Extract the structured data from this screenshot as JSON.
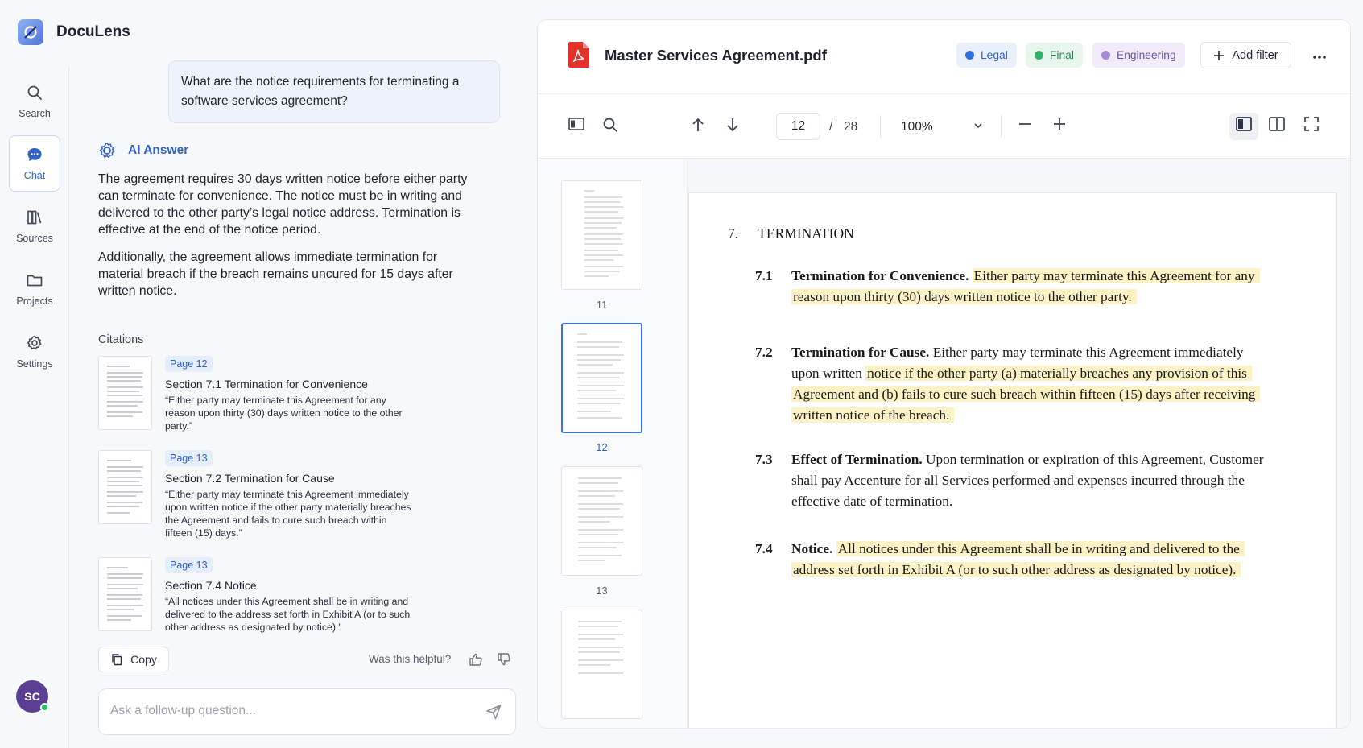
{
  "app": {
    "name": "DocuLens"
  },
  "nav": {
    "items": [
      {
        "label": "Search",
        "icon": "search-icon"
      },
      {
        "label": "Chat",
        "icon": "chat-icon"
      },
      {
        "label": "Sources",
        "icon": "library-icon"
      },
      {
        "label": "Projects",
        "icon": "folder-icon"
      },
      {
        "label": "Settings",
        "icon": "gear-icon"
      }
    ],
    "active": "Chat",
    "user_initials": "SC"
  },
  "chat": {
    "question": "What are the notice requirements for terminating a software services agreement?",
    "ai_label": "AI Answer",
    "answer_p1": "The agreement requires 30 days written notice before either party can terminate for convenience. The notice must be in writing and delivered to the other party’s legal notice address. Termination is effective at the end of the notice period.",
    "answer_p2": "Additionally, the agreement allows immediate termination for material breach if the breach remains uncured for 15 days after written notice.",
    "citations_label": "Citations",
    "citations": [
      {
        "page": "Page 12",
        "title": "Section 7.1 Termination for Convenience",
        "quote": "“Either party may terminate this Agreement for any reason upon thirty (30) days written notice to the other party.”"
      },
      {
        "page": "Page 13",
        "title": "Section 7.2 Termination for Cause",
        "quote": "“Either party may terminate this Agreement immediately upon written notice if the other party materially breaches the Agreement and fails to cure such breach within fifteen (15) days.”"
      },
      {
        "page": "Page 13",
        "title": "Section 7.4 Notice",
        "quote": "“All notices under this Agreement shall be in writing and delivered to the address set forth in Exhibit A (or to such other address as designated by notice).”"
      }
    ],
    "copy_label": "Copy",
    "helpful_label": "Was this helpful?",
    "followup_placeholder": "Ask a follow-up question..."
  },
  "viewer": {
    "doc_title": "Master Services Agreement.pdf",
    "tags": [
      {
        "label": "Legal",
        "color": "#2f6fe0",
        "bg": "#eaf1fd",
        "text": "#2f63c8"
      },
      {
        "label": "Final",
        "color": "#2fb36a",
        "bg": "#e8f6ee",
        "text": "#2a8f55"
      },
      {
        "label": "Engineering",
        "color": "#a48ad8",
        "bg": "#f1ecfa",
        "text": "#6c55a8"
      }
    ],
    "add_filter_label": "Add filter",
    "page_current": "12",
    "page_sep": "/",
    "page_total": "28",
    "zoom": "100%",
    "thumbnails": [
      "11",
      "12",
      "13"
    ],
    "active_thumbnail": "12"
  },
  "document": {
    "section_num": "7.",
    "section_title": "TERMINATION",
    "clauses": [
      {
        "num": "7.1",
        "title": "Termination for Convenience.",
        "plain": "",
        "highlight": "Either party may terminate this Agreement for any reason upon thirty (30) days written notice to the other party."
      },
      {
        "num": "7.2",
        "title": "Termination for Cause.",
        "plain": "Either party may terminate this Agreement immediately upon written",
        "highlight": "notice if the other party (a) materially breaches any provision of this Agreement and (b) fails to cure such breach within fifteen (15) days after receiving written notice of the breach."
      },
      {
        "num": "7.3",
        "title": "Effect of Termination.",
        "plain": "Upon termination or expiration of this Agreement, Customer shall pay Accenture for all Services performed and expenses incurred through the effective date of termination.",
        "highlight": ""
      },
      {
        "num": "7.4",
        "title": "Notice.",
        "plain": "",
        "highlight": "All notices under this Agreement shall be in writing and delivered to the address set forth in Exhibit A (or to such other address as designated by notice)."
      }
    ]
  }
}
